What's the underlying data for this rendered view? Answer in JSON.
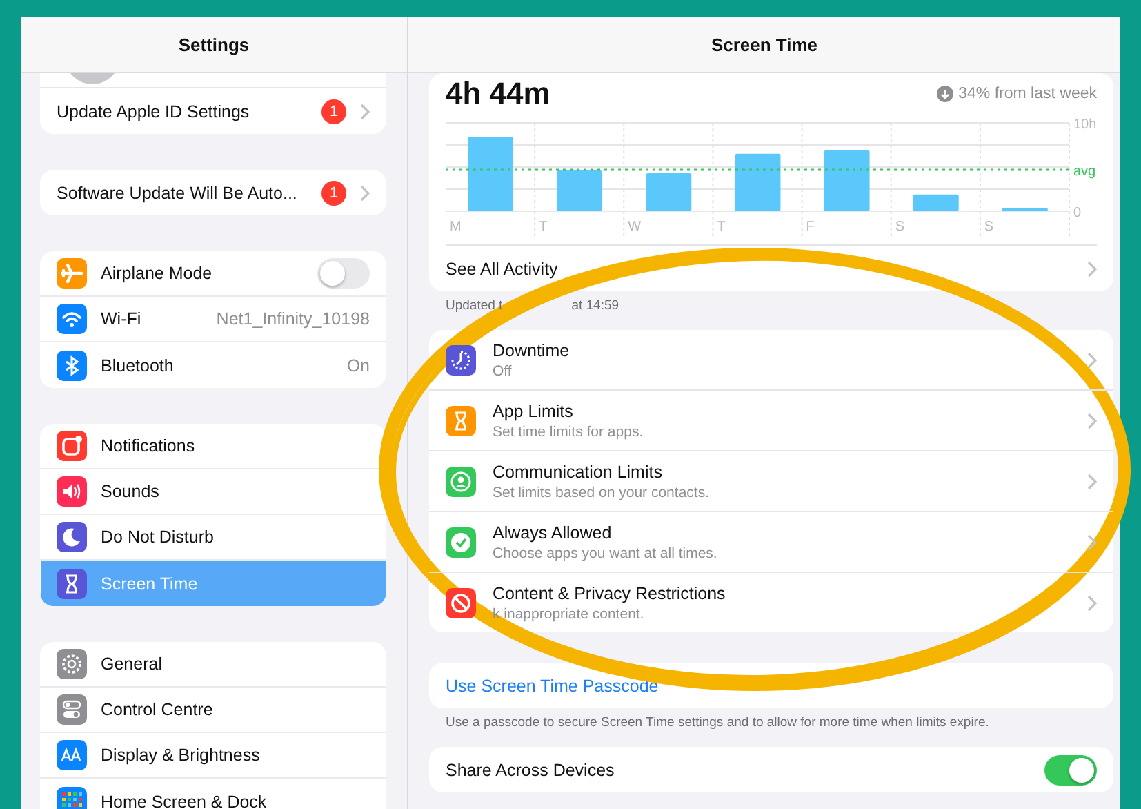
{
  "sidebar": {
    "title": "Settings",
    "groups": [
      {
        "cut_top": true,
        "items": [
          {
            "label": "Update Apple ID Settings",
            "badge": "1",
            "chevron": true,
            "selected": false
          }
        ]
      },
      {
        "items": [
          {
            "label": "Software Update Will Be Auto...",
            "badge": "1",
            "chevron": true,
            "selected": false
          }
        ]
      },
      {
        "items": [
          {
            "label": "Airplane Mode",
            "kind": "toggle",
            "on": false,
            "selected": false
          },
          {
            "label": "Wi-Fi",
            "value": "Net1_Infinity_10198",
            "selected": false
          },
          {
            "label": "Bluetooth",
            "value": "On",
            "selected": false
          }
        ]
      },
      {
        "items": [
          {
            "label": "Notifications",
            "selected": false
          },
          {
            "label": "Sounds",
            "selected": false
          },
          {
            "label": "Do Not Disturb",
            "selected": false
          },
          {
            "label": "Screen Time",
            "selected": true
          }
        ]
      },
      {
        "items": [
          {
            "label": "General",
            "selected": false
          },
          {
            "label": "Control Centre",
            "selected": false
          },
          {
            "label": "Display & Brightness",
            "selected": false
          },
          {
            "label": "Home Screen & Dock",
            "selected": false
          }
        ]
      }
    ]
  },
  "detail": {
    "title": "Screen Time",
    "total": "4h 44m",
    "change": "34% from last week",
    "chart_data": {
      "type": "bar",
      "categories": [
        "M",
        "T",
        "W",
        "T",
        "F",
        "S",
        "S"
      ],
      "values": [
        8.4,
        4.6,
        4.3,
        6.5,
        6.9,
        1.9,
        0.4
      ],
      "ylim": [
        0,
        10
      ],
      "yticks": [
        {
          "value": 0,
          "label": "0"
        },
        {
          "value": 10,
          "label": "10h"
        }
      ]
    },
    "average_label": "avg",
    "activity_link": "See All Activity",
    "updated_note": [
      "Updated t",
      "at 14:59"
    ],
    "menu": [
      {
        "title": "Downtime",
        "subtitle": "Off"
      },
      {
        "title": "App Limits",
        "subtitle": "Set time limits for apps."
      },
      {
        "title": "Communication Limits",
        "subtitle": "Set limits based on your contacts."
      },
      {
        "title": "Always Allowed",
        "subtitle": "Choose apps you want at all times."
      },
      {
        "title": "Content & Privacy Restrictions",
        "subtitle": "k inappropriate content."
      }
    ],
    "passcode_link": "Use Screen Time Passcode",
    "passcode_note": "Use a passcode to secure Screen Time settings and to allow for more time when limits expire.",
    "share": {
      "label": "Share Across Devices",
      "on": true
    }
  }
}
